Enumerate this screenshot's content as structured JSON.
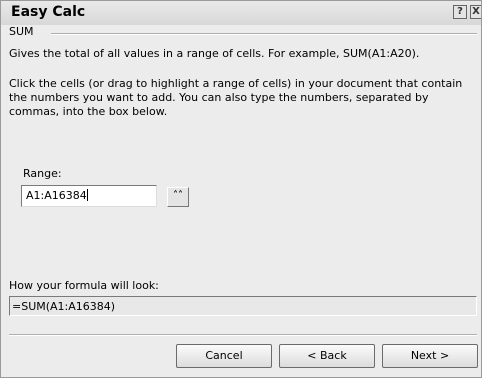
{
  "window": {
    "title": "Easy Calc",
    "help_glyph": "?",
    "close_glyph": "X"
  },
  "section": {
    "label": "SUM"
  },
  "description": "Gives the total of all values in a range of cells. For example, SUM(A1:A20).",
  "instructions": "Click the cells (or drag to highlight a range of cells) in your document that contain the numbers you want to add. You can also type the numbers, separated by commas, into the box below.",
  "range": {
    "label": "Range:",
    "value": "A1:A16384",
    "collapse_glyph": "˄˄"
  },
  "formula": {
    "label": "How your formula will look:",
    "value": "=SUM(A1:A16384)"
  },
  "buttons": {
    "cancel": "Cancel",
    "back": "< Back",
    "next": "Next >"
  },
  "colors": {
    "window_bg": "#ececec",
    "input_bg": "#ffffff",
    "formula_bg": "#e8e8e8"
  }
}
